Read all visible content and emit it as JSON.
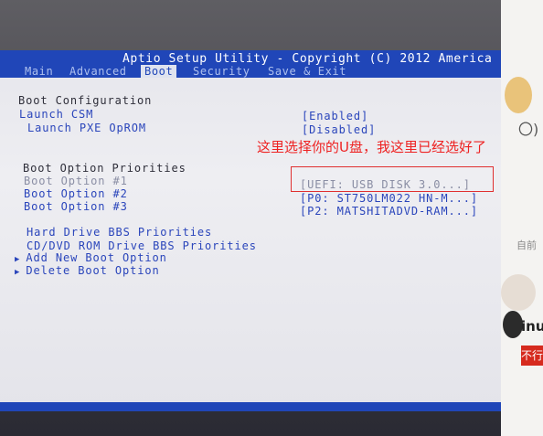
{
  "bios": {
    "title": "Aptio Setup Utility - Copyright (C) 2012 America",
    "tabs": [
      {
        "label": "Main"
      },
      {
        "label": "Advanced"
      },
      {
        "label": "Boot"
      },
      {
        "label": "Security"
      },
      {
        "label": "Save & Exit"
      }
    ],
    "active_tab": "Boot",
    "section_boot_config": "Boot Configuration",
    "launch_csm": {
      "label": "Launch CSM",
      "value": "[Enabled]"
    },
    "launch_pxe": {
      "label": "Launch PXE OpROM",
      "value": "[Disabled]"
    },
    "section_priorities": "Boot Option Priorities",
    "boot_options": [
      {
        "label": "Boot Option #1",
        "value": "[UEFI:  USB DISK 3.0...]"
      },
      {
        "label": "Boot Option #2",
        "value": "[P0: ST750LM022 HN-M...]"
      },
      {
        "label": "Boot Option #3",
        "value": "[P2: MATSHITADVD-RAM...]"
      }
    ],
    "hard_drive_bbs": "Hard Drive BBS Priorities",
    "cddvd_bbs": "CD/DVD ROM Drive BBS Priorities",
    "add_new_boot": "Add New Boot Option",
    "delete_boot": "Delete Boot Option",
    "submenu_glyph": "▶"
  },
  "annotation": {
    "text": "这里选择你的U盘，我这里已经选好了",
    "color": "#ee2222"
  },
  "background_page": {
    "paren": "〇)",
    "left_text": "自前",
    "inu_text": "inu",
    "badge_text": "不行"
  },
  "colors": {
    "bios_blue": "#2046b8",
    "bios_bg": "#e8e8ee",
    "value_blue": "#2a45bb"
  }
}
